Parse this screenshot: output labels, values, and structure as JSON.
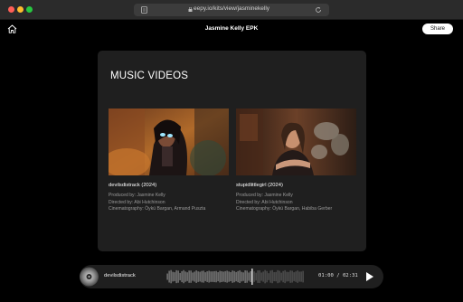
{
  "browser": {
    "url": "eepy.io/kits/view/jasminekelly"
  },
  "header": {
    "title": "Jasmine Kelly EPK",
    "share_label": "Share"
  },
  "section": {
    "title": "MUSIC VIDEOS"
  },
  "videos": [
    {
      "title": "devilsdistrack (2024)",
      "produced": "Produced by: Jasmine Kelly",
      "directed": "Directed by: Abi Hutchinson",
      "cinematography": "Cinematography: Öykü Bargan, Armand Puszta"
    },
    {
      "title": "stupidlittlegirl (2024)",
      "produced": "Produced by: Jasmine Kelly",
      "directed": "Directed by: Abi Hutchinson",
      "cinematography": "Cinematography: Öykü Bargan, Habiba Gerber"
    }
  ],
  "player": {
    "track": "devilsdistrack",
    "time": "01:00 / 02:31",
    "progress": 0.62
  },
  "colors": {
    "page_bg": "#000000",
    "card_bg": "#1f1f1f",
    "muted_text": "#9a9a9a"
  }
}
